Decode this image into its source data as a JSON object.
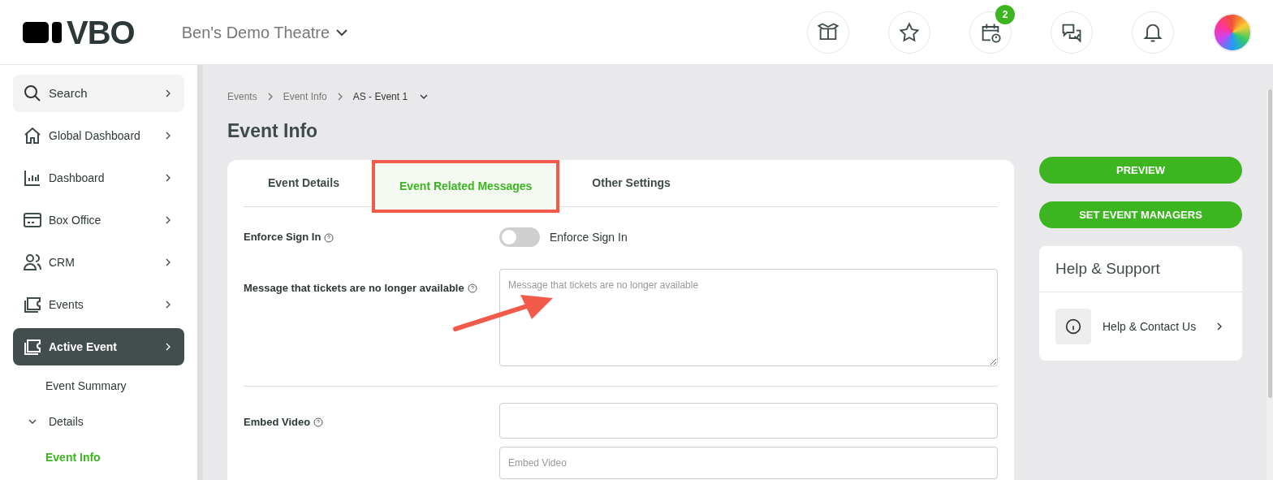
{
  "header": {
    "logo_text": "VBO",
    "venue": "Ben's Demo Theatre",
    "icon_buttons": [
      {
        "kind": "box"
      },
      {
        "kind": "star"
      },
      {
        "kind": "calendar",
        "badge": "2"
      },
      {
        "kind": "chat"
      },
      {
        "kind": "bell"
      }
    ]
  },
  "sidebar": {
    "search": "Search",
    "items": [
      {
        "label": "Global Dashboard",
        "kind": "home",
        "selected": false
      },
      {
        "label": "Dashboard",
        "kind": "chart",
        "selected": false
      },
      {
        "label": "Box Office",
        "kind": "card",
        "selected": false
      },
      {
        "label": "CRM",
        "kind": "people",
        "selected": false
      },
      {
        "label": "Events",
        "kind": "ticket",
        "selected": false
      },
      {
        "label": "Active Event",
        "kind": "ticket",
        "selected": true
      }
    ],
    "sub_items": [
      {
        "label": "Event Summary",
        "selected": false
      },
      {
        "label": "Details",
        "selected": false,
        "expanded": true,
        "children": [
          {
            "label": "Event Info",
            "selected": true
          }
        ]
      }
    ]
  },
  "breadcrumb": [
    "Events",
    "Event Info",
    "AS - Event 1"
  ],
  "page_title": "Event Info",
  "tabs": [
    {
      "label": "Event Details",
      "selected": false,
      "highlighted": false
    },
    {
      "label": "Event Related Messages",
      "selected": true,
      "highlighted": true
    },
    {
      "label": "Other Settings",
      "selected": false,
      "highlighted": false
    }
  ],
  "form": [
    {
      "kind": "toggle",
      "label": "Enforce Sign In",
      "on": false,
      "toggle_label": "Enforce Sign In"
    },
    {
      "kind": "textarea",
      "label": "Message that tickets are no longer available",
      "placeholder": "Message that tickets are no longer available",
      "pointed": true
    },
    {
      "kind": "video",
      "label": "Embed Video",
      "placeholder": "Embed Video"
    }
  ],
  "actions": [
    "PREVIEW",
    "SET EVENT MANAGERS"
  ],
  "help": {
    "title": "Help & Support",
    "link": "Help & Contact Us"
  }
}
